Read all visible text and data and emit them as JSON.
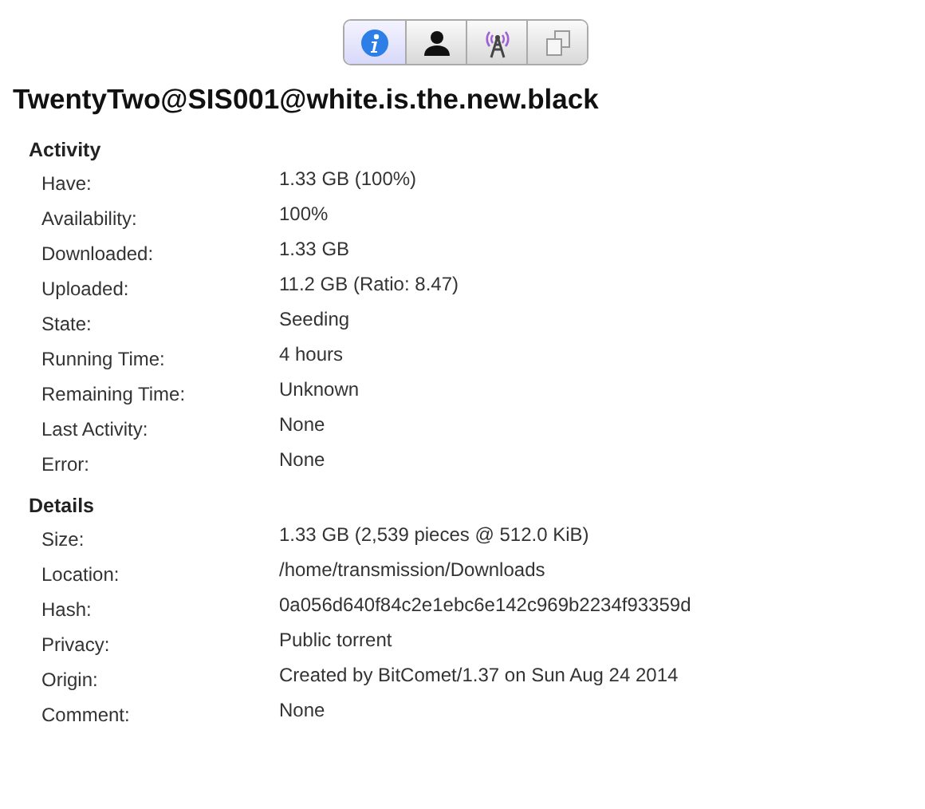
{
  "tabs": [
    {
      "kind": "info",
      "selected": true
    },
    {
      "kind": "person",
      "selected": false
    },
    {
      "kind": "antenna",
      "selected": false
    },
    {
      "kind": "files",
      "selected": false
    }
  ],
  "title": "TwentyTwo@SIS001@white.is.the.new.black",
  "sections": [
    {
      "heading": "Activity",
      "rows": [
        {
          "label": "Have:",
          "value": "1.33 GB (100%)"
        },
        {
          "label": "Availability:",
          "value": "100%"
        },
        {
          "label": "Downloaded:",
          "value": "1.33 GB"
        },
        {
          "label": "Uploaded:",
          "value": "11.2 GB (Ratio: 8.47)"
        },
        {
          "label": "State:",
          "value": "Seeding"
        },
        {
          "label": "Running Time:",
          "value": "4 hours"
        },
        {
          "label": "Remaining Time:",
          "value": "Unknown"
        },
        {
          "label": "Last Activity:",
          "value": "None"
        },
        {
          "label": "Error:",
          "value": "None"
        }
      ]
    },
    {
      "heading": "Details",
      "rows": [
        {
          "label": "Size:",
          "value": "1.33 GB (2,539 pieces @ 512.0 KiB)"
        },
        {
          "label": "Location:",
          "value": "/home/transmission/Downloads"
        },
        {
          "label": "Hash:",
          "value": "0a056d640f84c2e1ebc6e142c969b2234f93359d"
        },
        {
          "label": "Privacy:",
          "value": "Public torrent"
        },
        {
          "label": "Origin:",
          "value": "Created by BitComet/1.37 on Sun Aug 24 2014"
        },
        {
          "label": "Comment:",
          "value": "None"
        }
      ]
    }
  ]
}
